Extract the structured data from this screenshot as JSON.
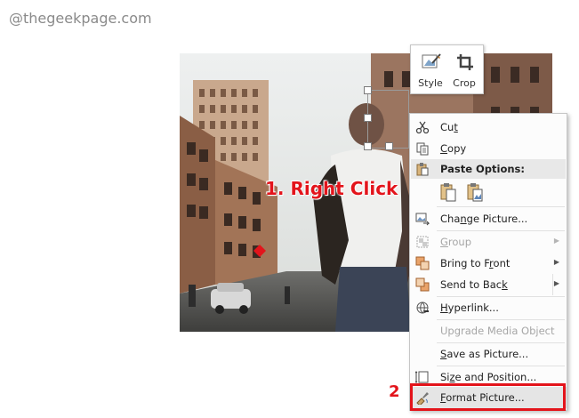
{
  "watermark": "@thegeekpage.com",
  "annotations": {
    "step1": "1. Right Click",
    "step2": "2"
  },
  "mini_toolbar": {
    "style_label": "Style",
    "crop_label": "Crop"
  },
  "menu": {
    "cut": {
      "pre": "Cu",
      "key": "t",
      "post": ""
    },
    "copy": {
      "pre": "",
      "key": "C",
      "post": "opy"
    },
    "paste_options": "Paste Options:",
    "change_picture": {
      "pre": "Cha",
      "key": "n",
      "post": "ge Picture..."
    },
    "group": {
      "pre": "",
      "key": "G",
      "post": "roup"
    },
    "bring_to_front": {
      "pre": "Bring to F",
      "key": "r",
      "post": "ont"
    },
    "send_to_back": {
      "pre": "Send to Bac",
      "key": "k",
      "post": ""
    },
    "hyperlink": {
      "pre": "",
      "key": "H",
      "post": "yperlink..."
    },
    "upgrade_media": "Upgrade Media Object",
    "save_as_picture": {
      "pre": "",
      "key": "S",
      "post": "ave as Picture..."
    },
    "size_position": {
      "pre": "Si",
      "key": "z",
      "post": "e and Position..."
    },
    "format_picture": {
      "pre": "",
      "key": "F",
      "post": "ormat Picture..."
    }
  },
  "colors": {
    "annotation_red": "#e3141b"
  }
}
